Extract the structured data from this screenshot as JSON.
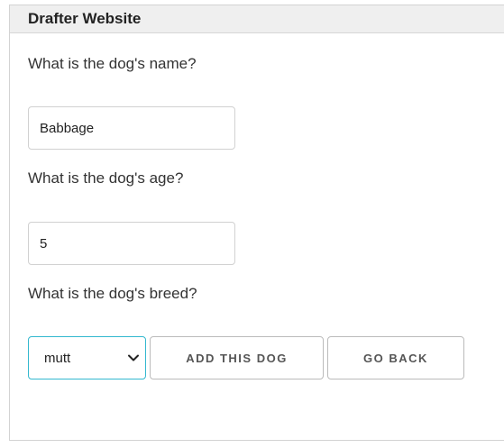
{
  "header": {
    "title": "Drafter Website"
  },
  "form": {
    "name_question": "What is the dog's name?",
    "name_value": "Babbage",
    "age_question": "What is the dog's age?",
    "age_value": "5",
    "breed_question": "What is the dog's breed?",
    "breed_selected": "mutt"
  },
  "buttons": {
    "add_label": "ADD THIS DOG",
    "back_label": "GO BACK"
  },
  "icons": {
    "select_arrow": "chevron-down-icon"
  },
  "colors": {
    "header_bg": "#efefef",
    "select_focus_border": "#33b8cf",
    "button_text": "#555555"
  }
}
